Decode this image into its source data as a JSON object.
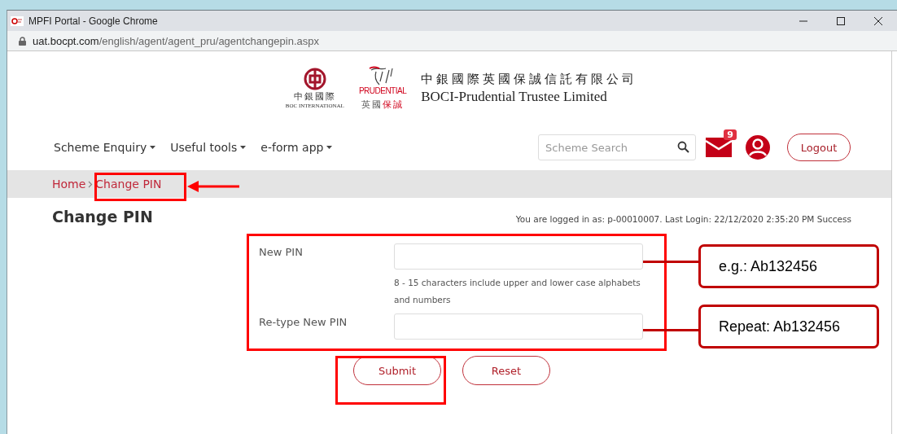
{
  "window": {
    "title": "MPFI Portal - Google Chrome"
  },
  "address_bar": {
    "host": "uat.bocpt.com",
    "path": "/english/agent/agent_pru/agentchangepin.aspx"
  },
  "header": {
    "boc_logo": {
      "name": "中銀國際",
      "subtitle": "BOC INTERNATIONAL"
    },
    "prudential_logo": {
      "name": "PRUDENTIAL",
      "chinese_plain": "英國",
      "chinese_red": "保誠"
    },
    "company": {
      "chinese": "中銀國際英國保誠信託有限公司",
      "english": "BOCI-Prudential Trustee Limited"
    }
  },
  "nav": {
    "menus": [
      "Scheme Enquiry",
      "Useful tools",
      "e-form app"
    ],
    "search": {
      "placeholder": "Scheme Search"
    },
    "mail_badge": "9",
    "logout": "Logout"
  },
  "breadcrumb": [
    "Home",
    "Change PIN"
  ],
  "page": {
    "title": "Change PIN",
    "login_info": "You are logged in as: p-00010007. Last Login: 22/12/2020 2:35:20 PM Success"
  },
  "form": {
    "fields": [
      {
        "label": "New PIN",
        "hint": "8 - 15 characters include upper and lower case alphabets and numbers"
      },
      {
        "label": "Re-type New PIN"
      }
    ],
    "buttons": [
      "Submit",
      "Reset"
    ]
  },
  "annotations": {
    "callouts": [
      "e.g.: Ab132456",
      "Repeat: Ab132456"
    ]
  }
}
